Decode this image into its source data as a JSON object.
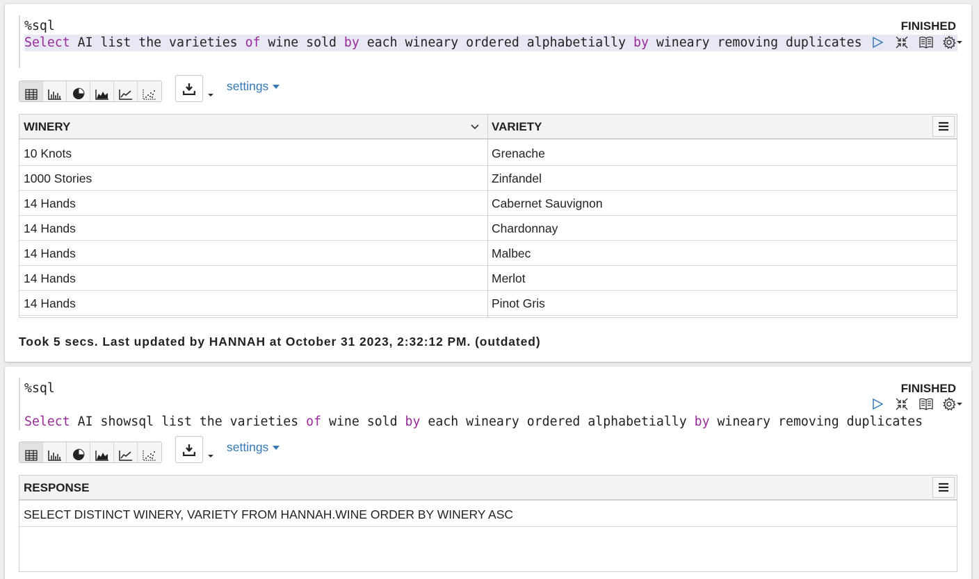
{
  "paragraph1": {
    "magic": "%sql",
    "query_tokens": [
      {
        "t": "Select",
        "kw": true
      },
      {
        "t": " AI list the varieties ",
        "kw": false
      },
      {
        "t": "of",
        "kw": true
      },
      {
        "t": " wine sold ",
        "kw": false
      },
      {
        "t": "by",
        "kw": true
      },
      {
        "t": " each wineary ordered alphabetially ",
        "kw": false
      },
      {
        "t": "by",
        "kw": true
      },
      {
        "t": " wineary removing duplicates",
        "kw": false
      }
    ],
    "status": "FINISHED",
    "settings_label": "settings",
    "table": {
      "columns": [
        "WINERY",
        "VARIETY"
      ],
      "rows": [
        [
          "10 Knots",
          "Grenache"
        ],
        [
          "1000 Stories",
          "Zinfandel"
        ],
        [
          "14 Hands",
          "Cabernet Sauvignon"
        ],
        [
          "14 Hands",
          "Chardonnay"
        ],
        [
          "14 Hands",
          "Malbec"
        ],
        [
          "14 Hands",
          "Merlot"
        ],
        [
          "14 Hands",
          "Pinot Gris"
        ]
      ]
    },
    "footer": "Took 5 secs. Last updated by HANNAH at October 31 2023, 2:32:12 PM. (outdated)"
  },
  "paragraph2": {
    "magic": "%sql",
    "query_tokens": [
      {
        "t": "Select",
        "kw": true
      },
      {
        "t": " AI showsql list the varieties ",
        "kw": false
      },
      {
        "t": "of",
        "kw": true
      },
      {
        "t": " wine sold ",
        "kw": false
      },
      {
        "t": "by",
        "kw": true
      },
      {
        "t": " each wineary ordered alphabetially ",
        "kw": false
      },
      {
        "t": "by",
        "kw": true
      },
      {
        "t": " wineary removing duplicates",
        "kw": false
      }
    ],
    "status": "FINISHED",
    "settings_label": "settings",
    "table": {
      "columns": [
        "RESPONSE"
      ],
      "rows": [
        [
          "SELECT DISTINCT WINERY, VARIETY FROM HANNAH.WINE ORDER BY WINERY ASC"
        ]
      ]
    }
  },
  "icons": {
    "run": "play-icon",
    "collapse": "collapse-icon",
    "book": "book-icon",
    "gear": "gear-icon",
    "viz": [
      "table-icon",
      "bar-chart-icon",
      "pie-chart-icon",
      "area-chart-icon",
      "line-chart-icon",
      "scatter-chart-icon"
    ],
    "download": "download-icon",
    "menu": "menu-icon"
  },
  "colors": {
    "keyword": "#9a2a9a",
    "link": "#3478b6",
    "run": "#3478b6"
  }
}
